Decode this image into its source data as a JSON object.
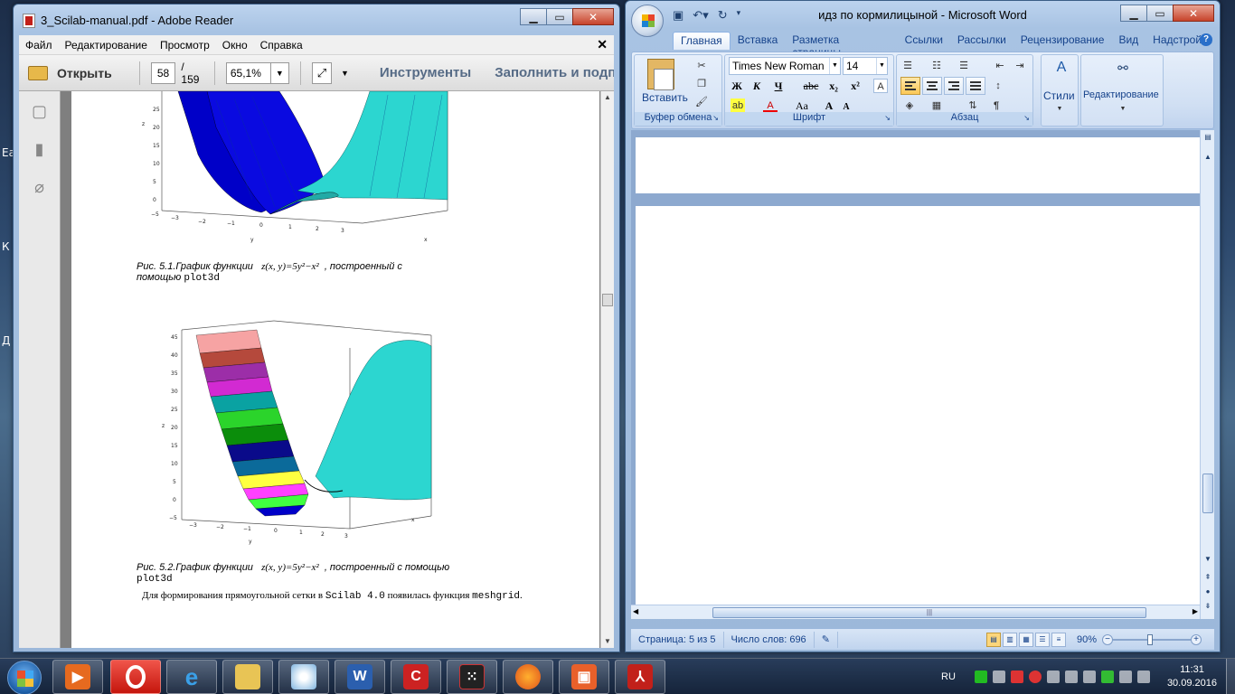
{
  "desktop_chars": [
    "Ea",
    "К",
    "Д"
  ],
  "adobe": {
    "title": "3_Scilab-manual.pdf - Adobe Reader",
    "menu": [
      "Файл",
      "Редактирование",
      "Просмотр",
      "Окно",
      "Справка"
    ],
    "toolbar": {
      "open": "Открыть",
      "page": "58",
      "page_total": "/ 159",
      "zoom": "65,1%",
      "tools": "Инструменты",
      "fill_sign": "Заполнить и подпи"
    },
    "pdf": {
      "fig1_caption_prefix": "Рис. 5.1.График функции",
      "formula": "z(x, y)=5y²−x²",
      "fig1_caption_suffix": ", построенный с",
      "fig1_caption_line2_prefix": "помощью",
      "plot3d": "plot3d",
      "fig2_caption_prefix": "Рис. 5.2.График функции",
      "fig2_caption_suffix": ", построенный с помощью",
      "body_text_prefix": "Для формирования прямоугольной сетки в",
      "scilab": "Scilab 4.0",
      "body_text_mid": "появилась функция",
      "meshgrid": "meshgrid",
      "body_text_end": ".",
      "fig1_yticks": [
        "25",
        "20",
        "15",
        "10",
        "5",
        "0",
        "−5"
      ],
      "fig1_xticks": [
        "−3",
        "−2",
        "−1",
        "0",
        "1",
        "2",
        "3"
      ],
      "fig2_yticks": [
        "45",
        "40",
        "35",
        "30",
        "25",
        "20",
        "15",
        "10",
        "5",
        "0",
        "−5"
      ],
      "fig2_xticks": [
        "−3",
        "−2",
        "−1",
        "0",
        "1",
        "2",
        "3"
      ],
      "z_label": "z",
      "y_label": "y",
      "x_label": "x"
    }
  },
  "word": {
    "title": "идз по кормилицыной - Microsoft Word",
    "tabs": [
      "Главная",
      "Вставка",
      "Разметка страницы",
      "Ссылки",
      "Рассылки",
      "Рецензирование",
      "Вид",
      "Надстройки"
    ],
    "ribbon": {
      "paste": "Вставить",
      "clipboard_group": "Буфер обмена",
      "font_name": "Times New Roman",
      "font_size": "14",
      "font_group": "Шрифт",
      "bold": "Ж",
      "italic": "К",
      "underline": "Ч",
      "strike": "abc",
      "sub": "x₂",
      "sup": "x²",
      "changecase": "Aa",
      "grow": "A",
      "shrink": "A",
      "paragraph_group": "Абзац",
      "styles": "Стили",
      "editing": "Редактирование"
    },
    "status": {
      "page": "Страница: 5 из 5",
      "words": "Число слов: 696",
      "zoom": "90%"
    }
  },
  "taskbar": {
    "lang": "RU",
    "time": "11:31",
    "date": "30.09.2016"
  }
}
